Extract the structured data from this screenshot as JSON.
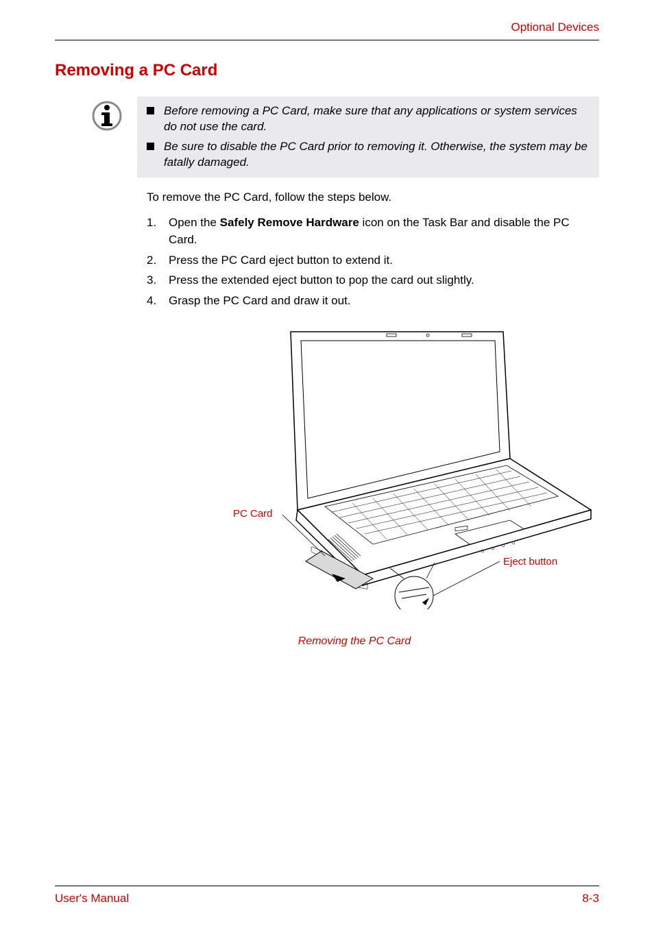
{
  "header": {
    "section": "Optional Devices"
  },
  "title": "Removing a PC Card",
  "notes": [
    "Before removing a PC Card, make sure that any applications or system services do not use the card.",
    "Be sure to disable the PC Card prior to removing it. Otherwise, the system may be fatally damaged."
  ],
  "intro": "To remove the PC Card, follow the steps below.",
  "steps": [
    {
      "num": "1.",
      "prefix": "Open the ",
      "bold": "Safely Remove Hardware",
      "suffix": " icon on the Task Bar and disable the PC Card."
    },
    {
      "num": "2.",
      "text": "Press the PC Card eject button to extend it."
    },
    {
      "num": "3.",
      "text": "Press the extended eject button to pop the card out slightly."
    },
    {
      "num": "4.",
      "text": "Grasp the PC Card and draw it out."
    }
  ],
  "figure": {
    "label_pccard": "PC Card",
    "label_eject": "Eject button",
    "caption": "Removing the PC Card"
  },
  "footer": {
    "left": "User's Manual",
    "right": "8-3"
  }
}
